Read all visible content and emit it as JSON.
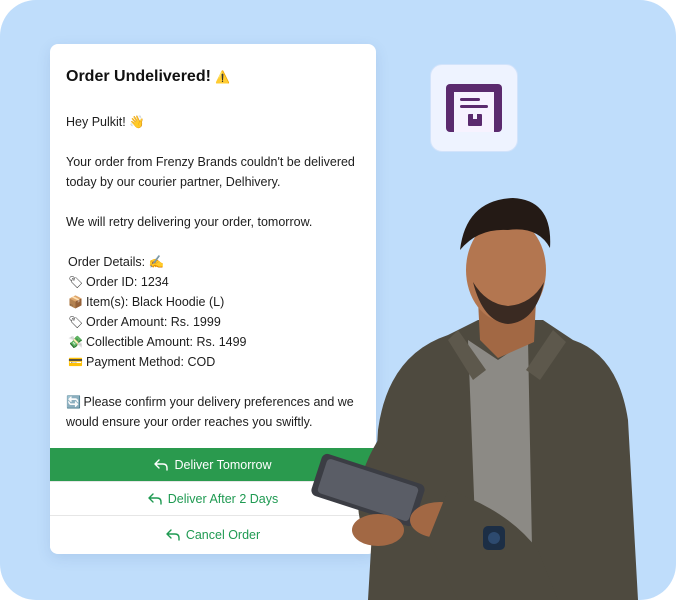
{
  "message": {
    "title": "Order Undelivered!",
    "title_emoji": "⚠️",
    "greeting": "Hey Pulkit! 👋",
    "body_1": "Your order from Frenzy Brands couldn't be delivered today by our courier partner, Delhivery.",
    "body_2": "We will retry delivering your order, tomorrow.",
    "details_header": "Order Details: ✍",
    "details": [
      {
        "emoji": "🏷",
        "text": "Order ID: 1234"
      },
      {
        "emoji": "📦",
        "text": "Item(s): Black Hoodie (L)"
      },
      {
        "emoji": "🏷",
        "text": "Order Amount: Rs. 1999"
      },
      {
        "emoji": "💸",
        "text": "Collectible Amount: Rs. 1499"
      },
      {
        "emoji": "💳",
        "text": "Payment Method: COD"
      }
    ],
    "confirm_emoji": "🔄",
    "confirm_text": "Please confirm your delivery preferences and we would ensure your order reaches you swiftly."
  },
  "actions": {
    "deliver_tomorrow": "Deliver Tomorrow",
    "deliver_after_2_days": "Deliver After 2 Days",
    "cancel_order": "Cancel Order"
  },
  "icons": {
    "reply": "reply-arrow-icon",
    "app": "shipping-box-icon"
  },
  "colors": {
    "background": "#bfddfb",
    "primary_button": "#2a9a4e",
    "accent_green": "#1f9a52",
    "app_icon": "#5b2a6e"
  }
}
